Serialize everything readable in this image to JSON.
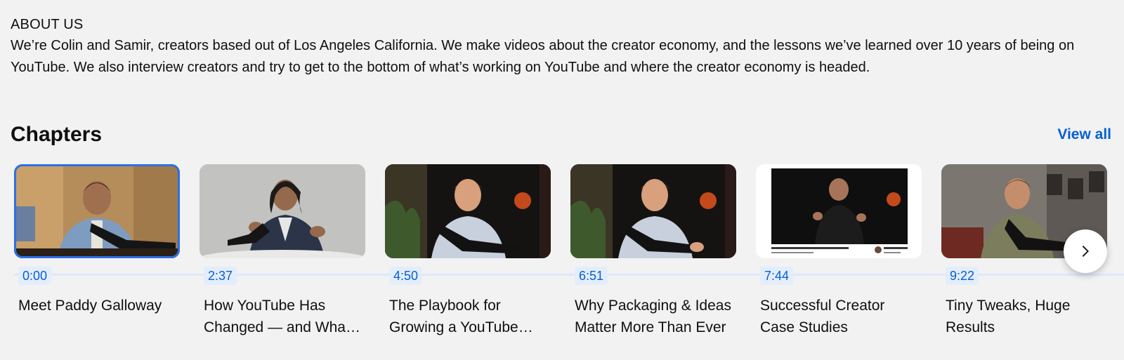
{
  "about": {
    "heading": "ABOUT US",
    "text": "We’re Colin and Samir, creators based out of Los Angeles California. We make videos about the creator economy, and the lessons we’ve learned over 10 years of being on YouTube. We also interview creators and try to get to the bottom of what’s working on YouTube and where the creator economy is headed."
  },
  "chapters": {
    "title": "Chapters",
    "view_all": "View all",
    "items": [
      {
        "time": "0:00",
        "title": "Meet Paddy Galloway",
        "active": true
      },
      {
        "time": "2:37",
        "title": "How YouTube Has Changed — and What Creators Should Know",
        "active": false
      },
      {
        "time": "4:50",
        "title": "The Playbook for Growing a YouTube Channel",
        "active": false
      },
      {
        "time": "6:51",
        "title": "Why Packaging & Ideas Matter More Than Ever",
        "active": false
      },
      {
        "time": "7:44",
        "title": "Successful Creator Case Studies",
        "active": false
      },
      {
        "time": "9:22",
        "title": "Tiny Tweaks, Huge Results",
        "active": false
      }
    ],
    "next_icon": "chevron-right-icon"
  },
  "colors": {
    "accent": "#065fd4",
    "active_border": "#2f6fe4",
    "background": "#f2f2f2"
  }
}
